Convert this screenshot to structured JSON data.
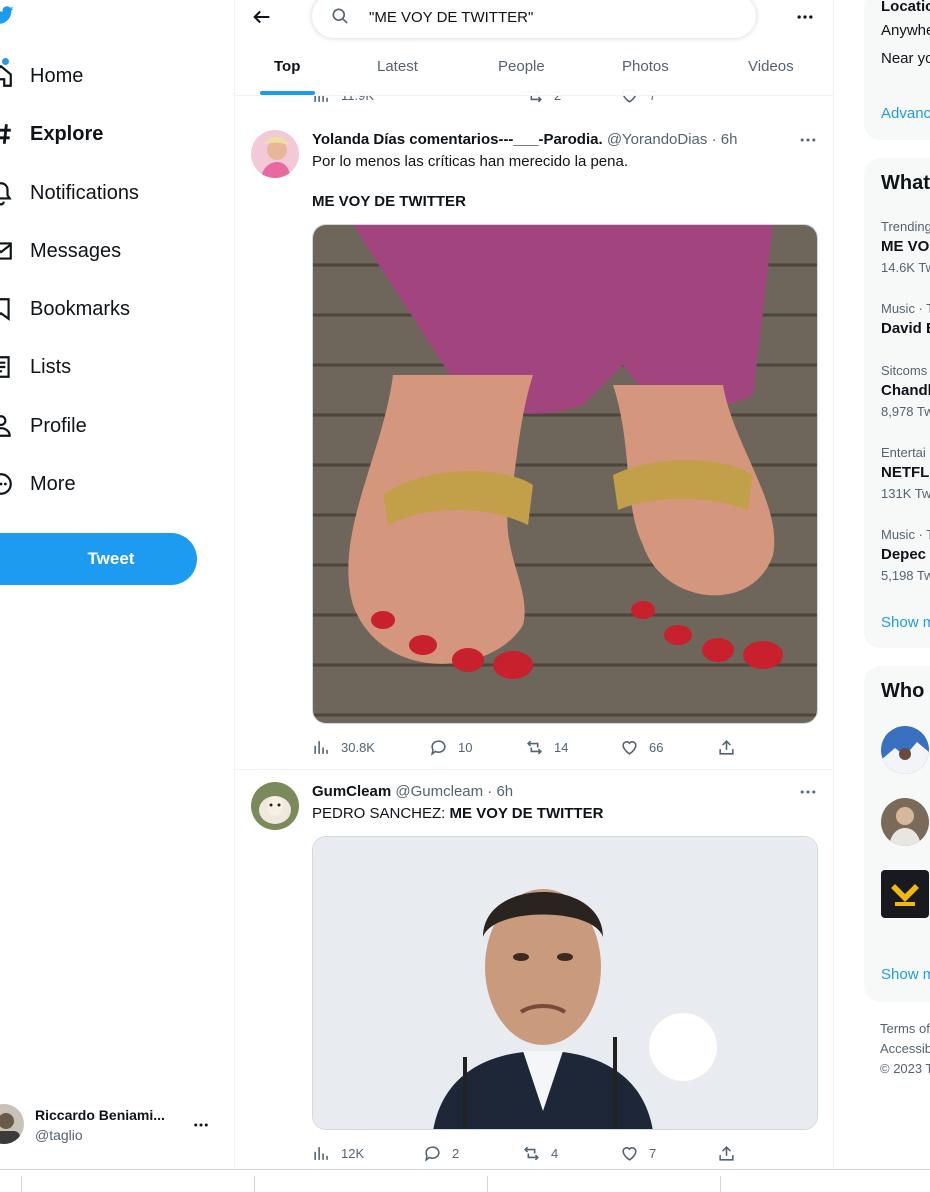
{
  "sidebar": {
    "items": [
      {
        "label": "Home",
        "icon": "home-icon"
      },
      {
        "label": "Explore",
        "icon": "hashtag-icon"
      },
      {
        "label": "Notifications",
        "icon": "bell-icon"
      },
      {
        "label": "Messages",
        "icon": "envelope-icon"
      },
      {
        "label": "Bookmarks",
        "icon": "bookmark-icon"
      },
      {
        "label": "Lists",
        "icon": "list-icon"
      },
      {
        "label": "Profile",
        "icon": "person-icon"
      },
      {
        "label": "More",
        "icon": "more-circle-icon"
      }
    ],
    "tweet_button": "Tweet",
    "account": {
      "name": "Riccardo Beniami...",
      "handle": "@taglio"
    }
  },
  "search": {
    "value": "\"ME VOY DE TWITTER\""
  },
  "tabs": [
    {
      "label": "Top",
      "active": true
    },
    {
      "label": "Latest"
    },
    {
      "label": "People"
    },
    {
      "label": "Photos"
    },
    {
      "label": "Videos"
    }
  ],
  "prev_tweet": {
    "views": "11.9K",
    "retweets": "2",
    "likes": "7"
  },
  "tweets": [
    {
      "name": "Yolanda Días comentarios---___-Parodia.",
      "handle": "@YorandoDias",
      "time": "6h",
      "line1": "Por lo menos las críticas han merecido la pena.",
      "line2": "ME VOY DE TWITTER",
      "views": "30.8K",
      "replies": "10",
      "retweets": "14",
      "likes": "66"
    },
    {
      "name": "GumCleam",
      "handle": "@Gumcleam",
      "time": "6h",
      "prefix": "PEDRO SANCHEZ: ",
      "highlight": "ME VOY DE TWITTER",
      "views": "12K",
      "replies": "2",
      "retweets": "4",
      "likes": "7"
    }
  ],
  "right": {
    "location": {
      "title": "Locatio",
      "opt1": "Anywhe",
      "opt2": "Near yo",
      "advanced": "Advanc"
    },
    "trends_title": "What",
    "trends": [
      {
        "context": "Trending",
        "name": "ME VOY",
        "count": "14.6K Tw"
      },
      {
        "context": "Music · T",
        "name": "David B",
        "count": ""
      },
      {
        "context": "Sitcoms",
        "name": "Chandl",
        "count": "8,978 Tw"
      },
      {
        "context": "Entertai",
        "name": "NETFLI",
        "count": "131K Twe"
      },
      {
        "context": "Music · T",
        "name": "Depec",
        "count": "5,198 Tw"
      }
    ],
    "trends_more": "Show m",
    "wtf_title": "Who",
    "wtf_more": "Show m",
    "footer": [
      "Terms of",
      "Accessib",
      "© 2023 T"
    ]
  },
  "colors": {
    "accent": "#1d9bf0",
    "text": "#0f1419",
    "muted": "#536471"
  }
}
